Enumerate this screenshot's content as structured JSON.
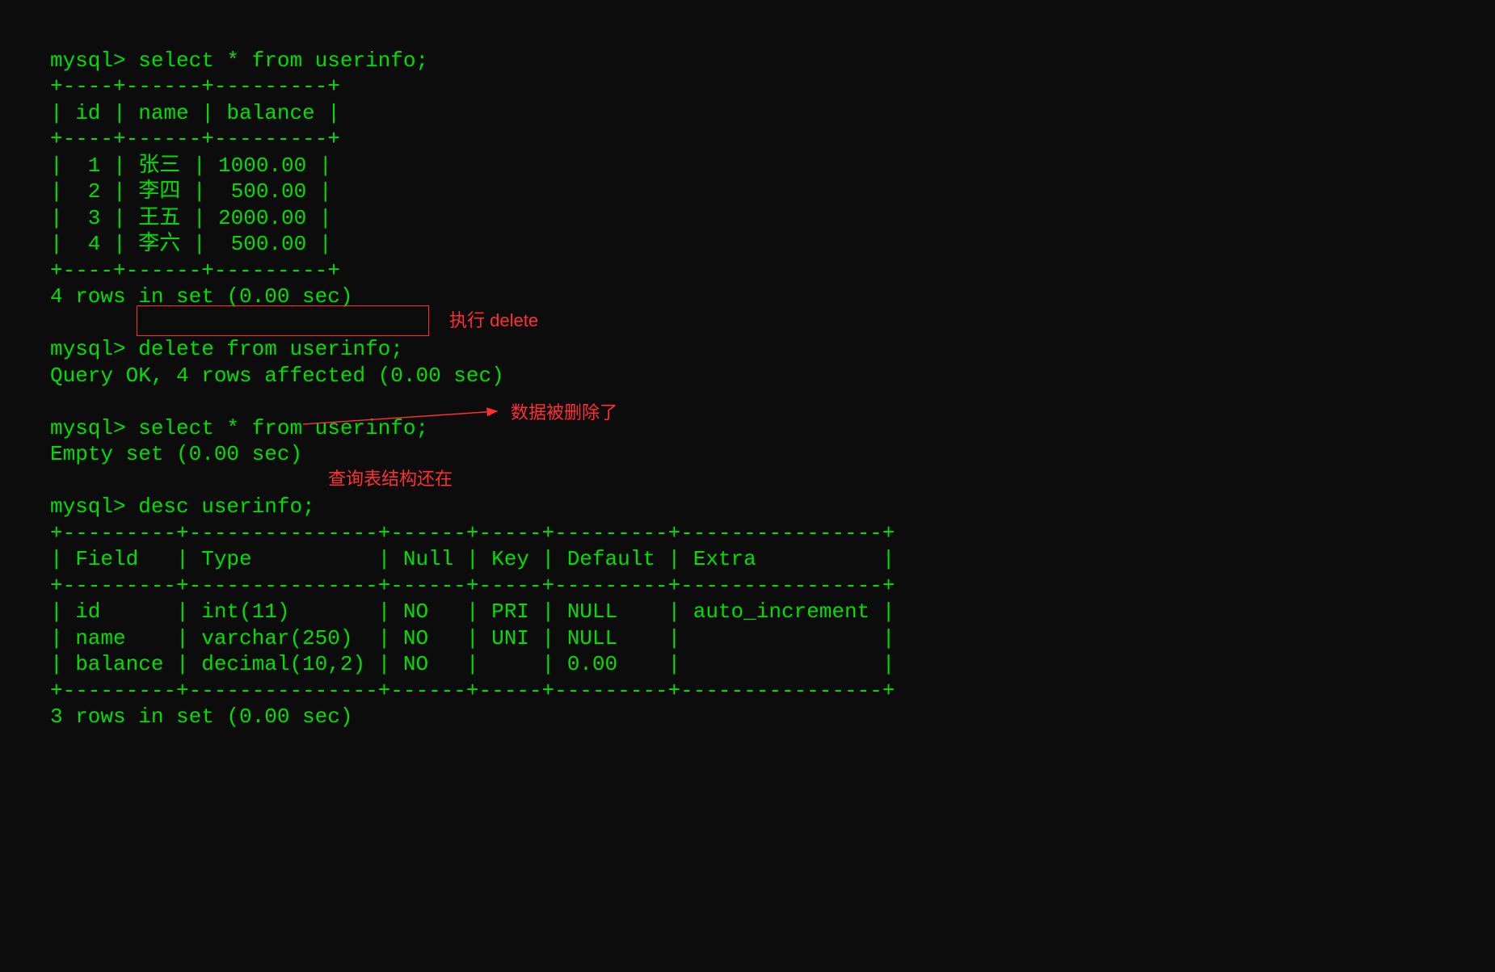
{
  "prompt": "mysql> ",
  "cmd": {
    "select": "select * from userinfo;",
    "delete": "delete from userinfo;",
    "desc": "desc userinfo;"
  },
  "result": {
    "rows4": "4 rows in set (0.00 sec)",
    "delok": "Query OK, 4 rows affected (0.00 sec)",
    "empty": "Empty set (0.00 sec)",
    "rows3": "3 rows in set (0.00 sec)"
  },
  "table1": {
    "border_top": "+----+------+---------+",
    "header": "| id | name | balance |",
    "border_mid": "+----+------+---------+",
    "rows": [
      "|  1 | 张三 | 1000.00 |",
      "|  2 | 李四 |  500.00 |",
      "|  3 | 王五 | 2000.00 |",
      "|  4 | 李六 |  500.00 |"
    ],
    "border_bot": "+----+------+---------+"
  },
  "table2": {
    "border_top": "+---------+---------------+------+-----+---------+----------------+",
    "header": "| Field   | Type          | Null | Key | Default | Extra          |",
    "border_mid": "+---------+---------------+------+-----+---------+----------------+",
    "rows": [
      "| id      | int(11)       | NO   | PRI | NULL    | auto_increment |",
      "| name    | varchar(250)  | NO   | UNI | NULL    |                |",
      "| balance | decimal(10,2) | NO   |     | 0.00    |                |"
    ],
    "border_bot": "+---------+---------------+------+-----+---------+----------------+"
  },
  "anno": {
    "exec_delete": "执行 delete",
    "data_deleted": "数据被删除了",
    "schema_remain": "查询表结构还在"
  },
  "table1_data": {
    "columns": [
      "id",
      "name",
      "balance"
    ],
    "records": [
      {
        "id": 1,
        "name": "张三",
        "balance": "1000.00"
      },
      {
        "id": 2,
        "name": "李四",
        "balance": "500.00"
      },
      {
        "id": 3,
        "name": "王五",
        "balance": "2000.00"
      },
      {
        "id": 4,
        "name": "李六",
        "balance": "500.00"
      }
    ]
  },
  "table2_data": {
    "columns": [
      "Field",
      "Type",
      "Null",
      "Key",
      "Default",
      "Extra"
    ],
    "records": [
      {
        "Field": "id",
        "Type": "int(11)",
        "Null": "NO",
        "Key": "PRI",
        "Default": "NULL",
        "Extra": "auto_increment"
      },
      {
        "Field": "name",
        "Type": "varchar(250)",
        "Null": "NO",
        "Key": "UNI",
        "Default": "NULL",
        "Extra": ""
      },
      {
        "Field": "balance",
        "Type": "decimal(10,2)",
        "Null": "NO",
        "Key": "",
        "Default": "0.00",
        "Extra": ""
      }
    ]
  }
}
